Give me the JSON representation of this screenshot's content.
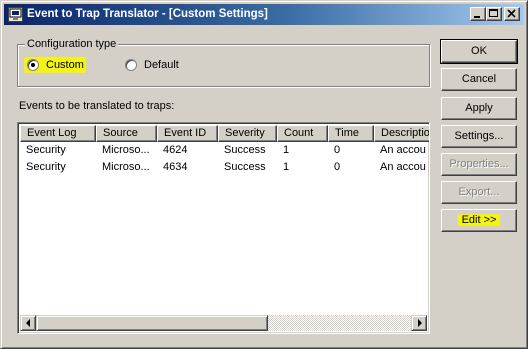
{
  "window": {
    "title": "Event to Trap Translator - [Custom Settings]",
    "title_controls": [
      "minimize-icon",
      "maximize-icon",
      "close-icon"
    ]
  },
  "config": {
    "legend": "Configuration type",
    "custom_label": "Custom",
    "default_label": "Default",
    "selected": "custom"
  },
  "events_label": "Events to be translated to traps:",
  "table": {
    "columns": [
      "Event Log",
      "Source",
      "Event ID",
      "Severity",
      "Count",
      "Time",
      "Description"
    ],
    "rows": [
      [
        "Security",
        "Microso...",
        "4624",
        "Success",
        "1",
        "0",
        "An accou"
      ],
      [
        "Security",
        "Microso...",
        "4634",
        "Success",
        "1",
        "0",
        "An accou"
      ]
    ]
  },
  "buttons": {
    "ok": "OK",
    "cancel": "Cancel",
    "apply": "Apply",
    "settings": "Settings...",
    "properties": "Properties...",
    "export": "Export...",
    "edit": "Edit >>"
  },
  "colors": {
    "highlight": "#f3f31a",
    "face": "#d4d0c8",
    "title_start": "#0a246a"
  }
}
